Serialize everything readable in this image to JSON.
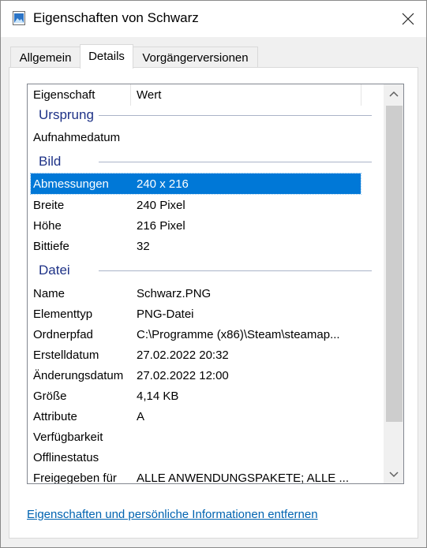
{
  "window": {
    "title": "Eigenschaften von Schwarz"
  },
  "tabs": [
    {
      "label": "Allgemein"
    },
    {
      "label": "Details"
    },
    {
      "label": "Vorgängerversionen"
    }
  ],
  "list": {
    "col_property": "Eigenschaft",
    "col_value": "Wert",
    "groups": [
      {
        "name": "Ursprung",
        "rows": [
          {
            "key": "Aufnahmedatum",
            "value": ""
          }
        ]
      },
      {
        "name": "Bild",
        "rows": [
          {
            "key": "Abmessungen",
            "value": "240 x 216"
          },
          {
            "key": "Breite",
            "value": "240 Pixel"
          },
          {
            "key": "Höhe",
            "value": "216 Pixel"
          },
          {
            "key": "Bittiefe",
            "value": "32"
          }
        ]
      },
      {
        "name": "Datei",
        "rows": [
          {
            "key": "Name",
            "value": "Schwarz.PNG"
          },
          {
            "key": "Elementtyp",
            "value": "PNG-Datei"
          },
          {
            "key": "Ordnerpfad",
            "value": "C:\\Programme (x86)\\Steam\\steamap..."
          },
          {
            "key": "Erstelldatum",
            "value": "27.02.2022 20:32"
          },
          {
            "key": "Änderungsdatum",
            "value": "27.02.2022 12:00"
          },
          {
            "key": "Größe",
            "value": "4,14 KB"
          },
          {
            "key": "Attribute",
            "value": "A"
          },
          {
            "key": "Verfügbarkeit",
            "value": ""
          },
          {
            "key": "Offlinestatus",
            "value": ""
          },
          {
            "key": "Freigegeben für",
            "value": "ALLE ANWENDUNGSPAKETE; ALLE ..."
          }
        ]
      }
    ]
  },
  "footer": {
    "link": "Eigenschaften und persönliche Informationen entfernen"
  },
  "colors": {
    "selection": "#0078d7",
    "group_heading": "#1e3287",
    "link": "#0063b1"
  }
}
